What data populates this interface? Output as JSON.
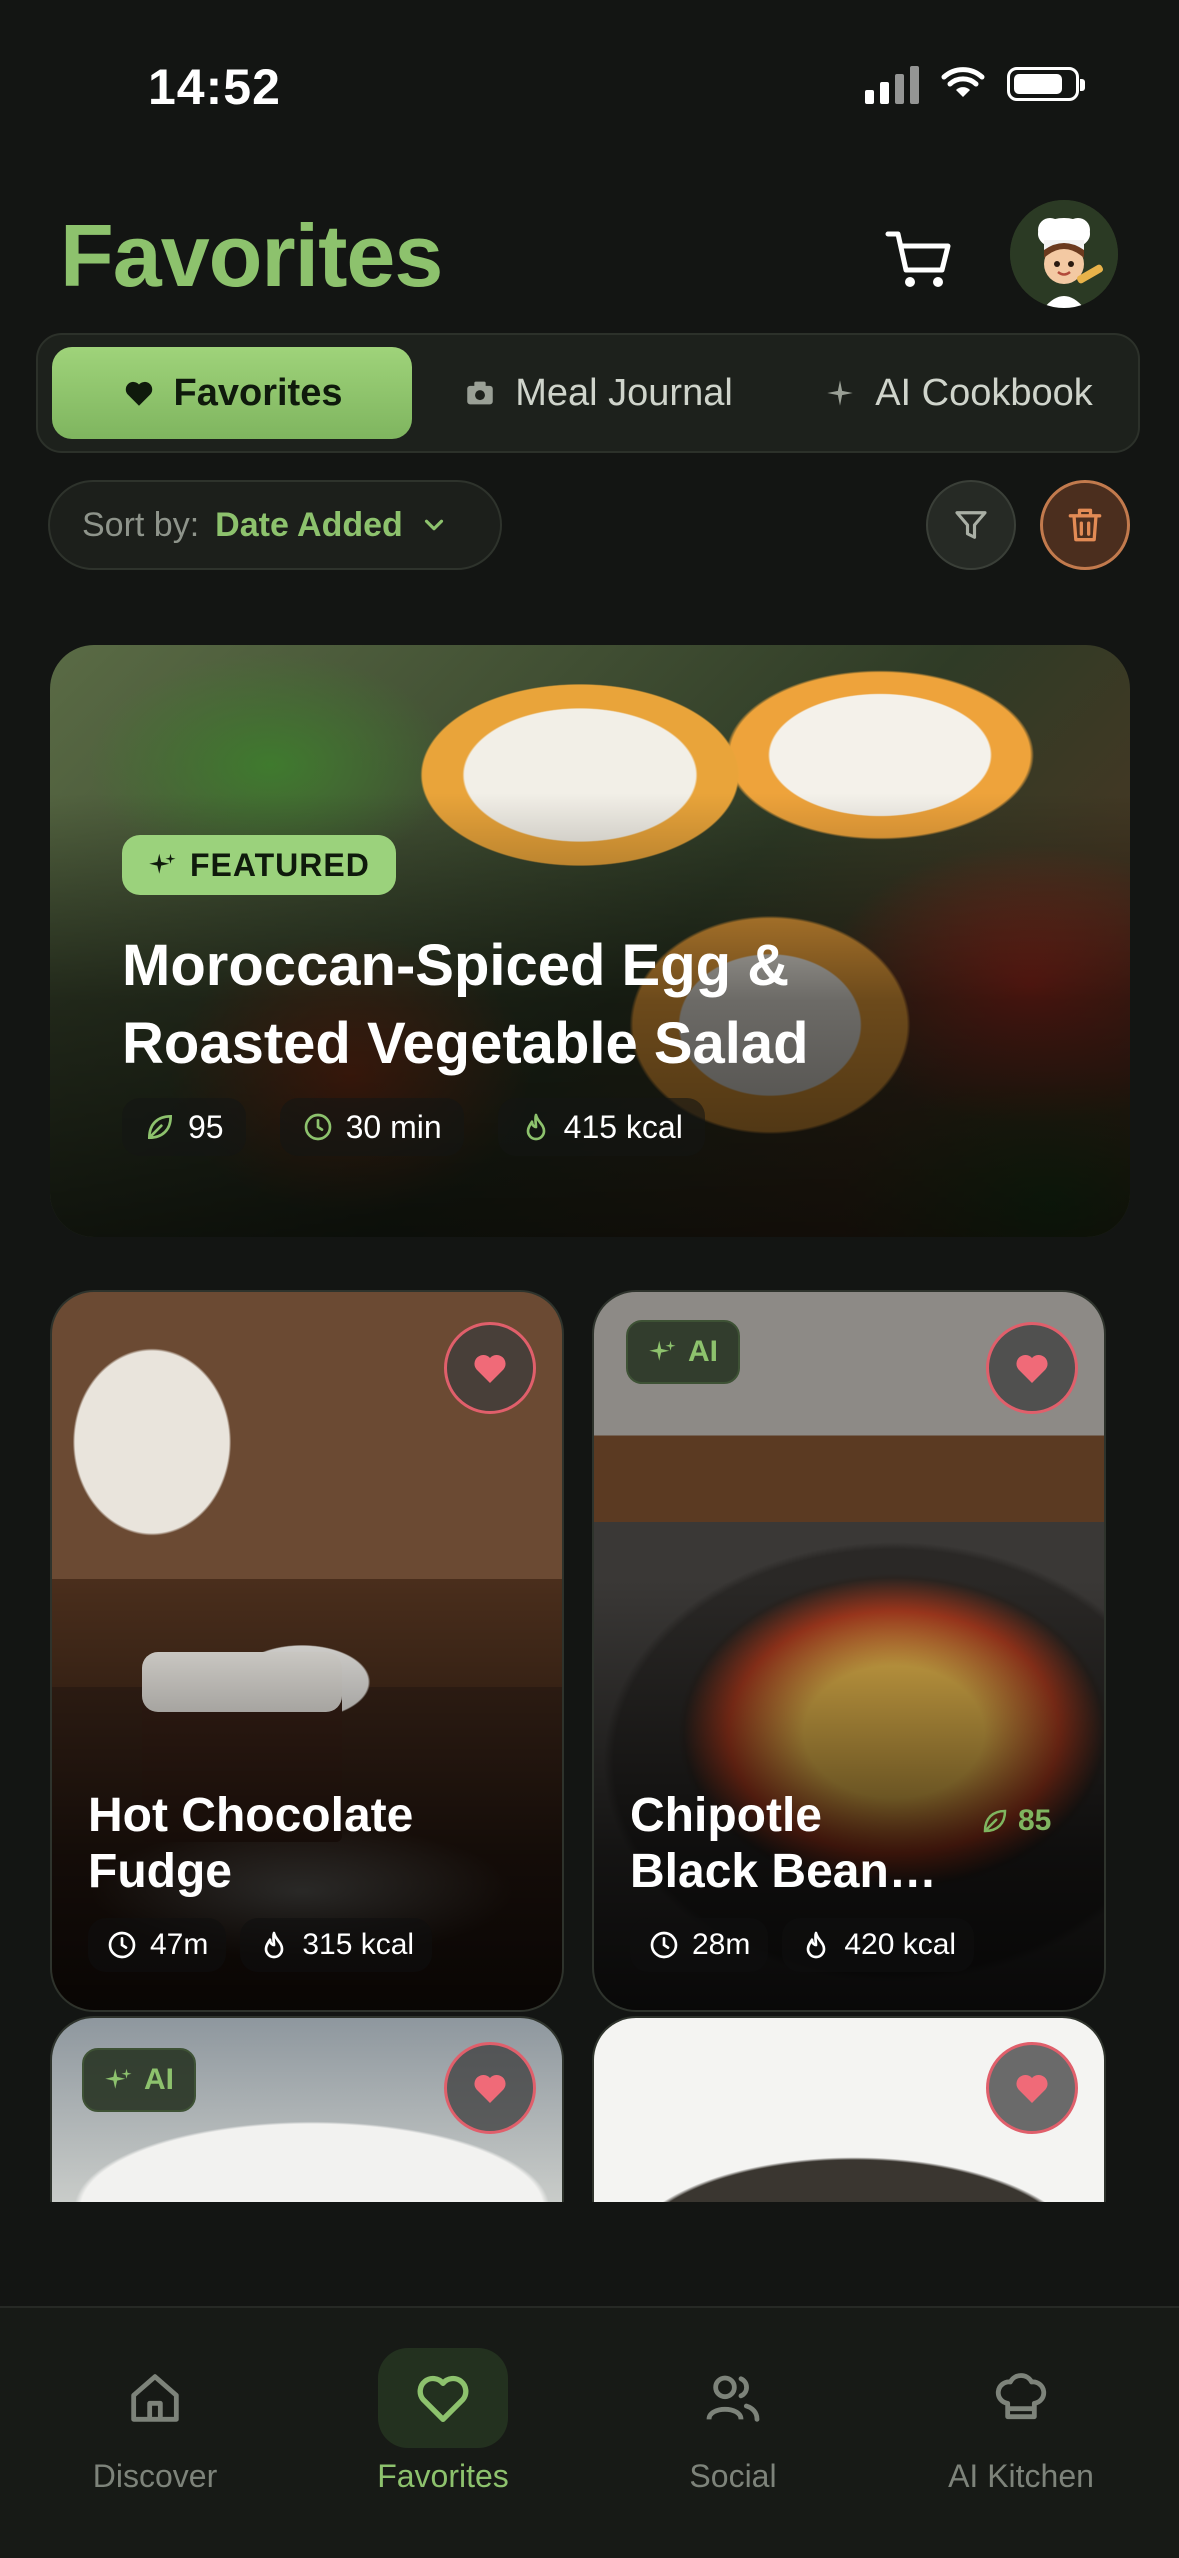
{
  "status_bar": {
    "time": "14:52"
  },
  "header": {
    "title": "Favorites"
  },
  "tabs": [
    {
      "label": "Favorites",
      "icon": "heart-icon",
      "active": true
    },
    {
      "label": "Meal Journal",
      "icon": "camera-icon",
      "active": false
    },
    {
      "label": "AI Cookbook",
      "icon": "sparkle-icon",
      "active": false
    }
  ],
  "sort": {
    "label": "Sort by:",
    "value": "Date Added"
  },
  "featured": {
    "badge": "FEATURED",
    "title": "Moroccan-Spiced Egg & Roasted Vegetable Salad",
    "score": "95",
    "time": "30 min",
    "calories": "415 kcal"
  },
  "cards": [
    {
      "title_line1": "Hot Chocolate",
      "title_line2": "Fudge",
      "time": "47m",
      "calories": "315 kcal",
      "favorited": true
    },
    {
      "badge": "AI",
      "title_line1": "Chipotle",
      "title_line2": "Black Bean…",
      "time": "28m",
      "calories": "420 kcal",
      "score": "85",
      "favorited": true
    },
    {
      "badge": "AI",
      "favorited": true
    },
    {
      "favorited": true
    }
  ],
  "bottom_nav": [
    {
      "label": "Discover",
      "icon": "home-icon"
    },
    {
      "label": "Favorites",
      "icon": "heart-icon",
      "active": true
    },
    {
      "label": "Social",
      "icon": "users-icon"
    },
    {
      "label": "AI Kitchen",
      "icon": "chef-hat-icon"
    }
  ],
  "colors": {
    "accent": "#8dc26d",
    "background": "#131513",
    "heart": "#e05f6b",
    "trash": "#c27a4d"
  }
}
